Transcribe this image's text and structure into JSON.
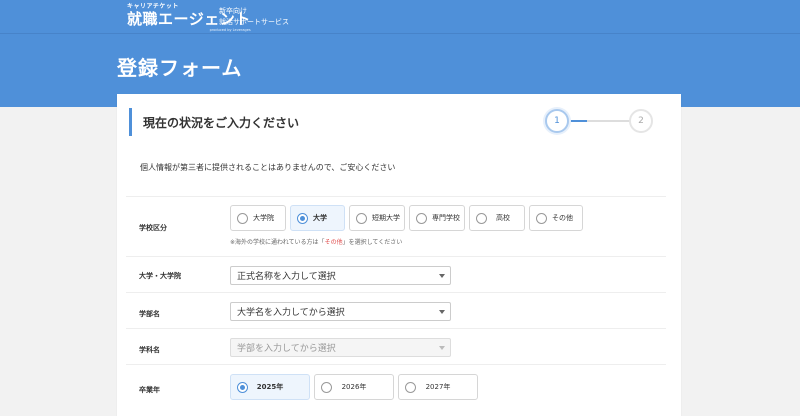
{
  "header": {
    "logo_small": "キャリアチケット",
    "logo_main": "就職エージェント",
    "logo_sub": "produced by Leverages",
    "tagline_1": "新卒向け",
    "tagline_2": "就活サポートサービス"
  },
  "page_title": "登録フォーム",
  "form": {
    "section_title": "現在の状況をご入力ください",
    "steps": [
      "1",
      "2"
    ],
    "current_step": 1,
    "privacy_note": "個人情報が第三者に提供されることはありませんので、ご安心ください",
    "school_type": {
      "label": "学校区分",
      "options": [
        "大学院",
        "大学",
        "短期大学",
        "専門学校",
        "高校",
        "その他"
      ],
      "selected": "大学",
      "hint_pre": "※海外の学校に通われている方は「",
      "hint_red": "その他",
      "hint_post": "」を選択してください"
    },
    "university": {
      "label": "大学・大学院",
      "value": "正式名称を入力して選択"
    },
    "faculty": {
      "label": "学部名",
      "value": "大学名を入力してから選択"
    },
    "department": {
      "label": "学科名",
      "value": "学部を入力してから選択"
    },
    "graduation_year": {
      "label": "卒業年",
      "options": [
        "2025年",
        "2026年",
        "2027年"
      ],
      "selected": "2025年"
    }
  },
  "colors": {
    "accent": "#4f90d9",
    "hint_red": "#e05050"
  }
}
